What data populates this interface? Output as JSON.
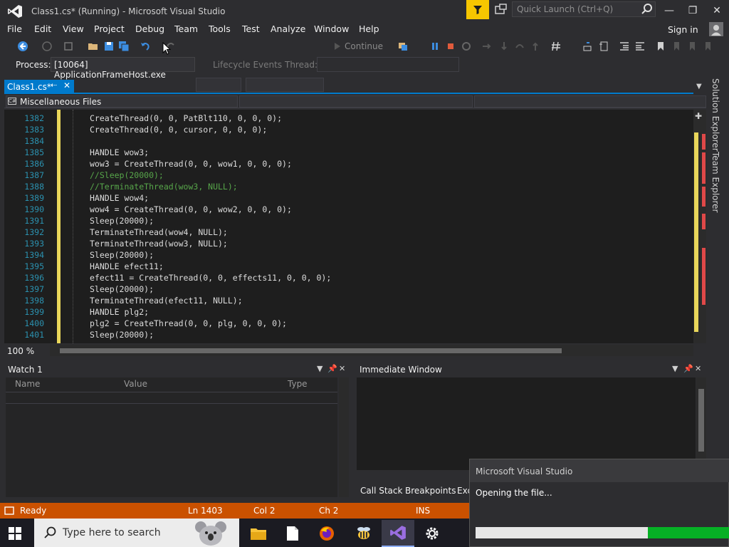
{
  "window": {
    "title": "Class1.cs* (Running) - Microsoft Visual Studio",
    "quick_launch_placeholder": "Quick Launch (Ctrl+Q)"
  },
  "menu": [
    "File",
    "Edit",
    "View",
    "Project",
    "Debug",
    "Team",
    "Tools",
    "Test",
    "Analyze",
    "Window",
    "Help"
  ],
  "account": {
    "sign_in": "Sign in"
  },
  "toolbar": {
    "continue_label": "Continue"
  },
  "debug_bar": {
    "process_label": "Process:",
    "process_value": "[10064] ApplicationFrameHost.exe",
    "lifecycle_label": "Lifecycle Events",
    "thread_label": "Thread:"
  },
  "editor": {
    "tab_label": "Class1.cs*",
    "nav_scope": "Miscellaneous Files",
    "zoom": "100 %",
    "lines": [
      {
        "n": "1382",
        "text": "CreateThread(0, 0, PatBlt110, 0, 0, 0);"
      },
      {
        "n": "1383",
        "text": "CreateThread(0, 0, cursor, 0, 0, 0);"
      },
      {
        "n": "1384",
        "text": ""
      },
      {
        "n": "1385",
        "text": "HANDLE wow3;"
      },
      {
        "n": "1386",
        "text": "wow3 = CreateThread(0, 0, wow1, 0, 0, 0);"
      },
      {
        "n": "1387",
        "text": "//Sleep(20000);",
        "comment": true
      },
      {
        "n": "1388",
        "text": "//TerminateThread(wow3, NULL);",
        "comment": true
      },
      {
        "n": "1389",
        "text": "HANDLE wow4;"
      },
      {
        "n": "1390",
        "text": "wow4 = CreateThread(0, 0, wow2, 0, 0, 0);"
      },
      {
        "n": "1391",
        "text": "Sleep(20000);"
      },
      {
        "n": "1392",
        "text": "TerminateThread(wow4, NULL);"
      },
      {
        "n": "1393",
        "text": "TerminateThread(wow3, NULL);"
      },
      {
        "n": "1394",
        "text": "Sleep(20000);"
      },
      {
        "n": "1395",
        "text": "HANDLE efect11;"
      },
      {
        "n": "1396",
        "text": "efect11 = CreateThread(0, 0, effects11, 0, 0, 0);"
      },
      {
        "n": "1397",
        "text": "Sleep(20000);"
      },
      {
        "n": "1398",
        "text": "TerminateThread(efect11, NULL);"
      },
      {
        "n": "1399",
        "text": "HANDLE plg2;"
      },
      {
        "n": "1400",
        "text": "plg2 = CreateThread(0, 0, plg, 0, 0, 0);"
      },
      {
        "n": "1401",
        "text": "Sleep(20000);"
      }
    ]
  },
  "side_tabs": [
    "Solution Explorer",
    "Team Explorer"
  ],
  "watch": {
    "title": "Watch 1",
    "columns": [
      "Name",
      "Value",
      "Type"
    ]
  },
  "immediate": {
    "title": "Immediate Window"
  },
  "bottom_tabs": [
    "Call Stack",
    "Breakpoints",
    "Exc"
  ],
  "status": {
    "state": "Ready",
    "ln": "Ln 1403",
    "col": "Col 2",
    "ch": "Ch 2",
    "mode": "INS"
  },
  "taskbar": {
    "search_placeholder": "Type here to search"
  },
  "popup": {
    "title": "Microsoft Visual Studio",
    "message": "Opening the file...",
    "progress_percent": 68
  },
  "colors": {
    "accent": "#007acc",
    "status_debug": "#ca5100",
    "progress": "#06b025",
    "feedback": "#f7c600"
  }
}
